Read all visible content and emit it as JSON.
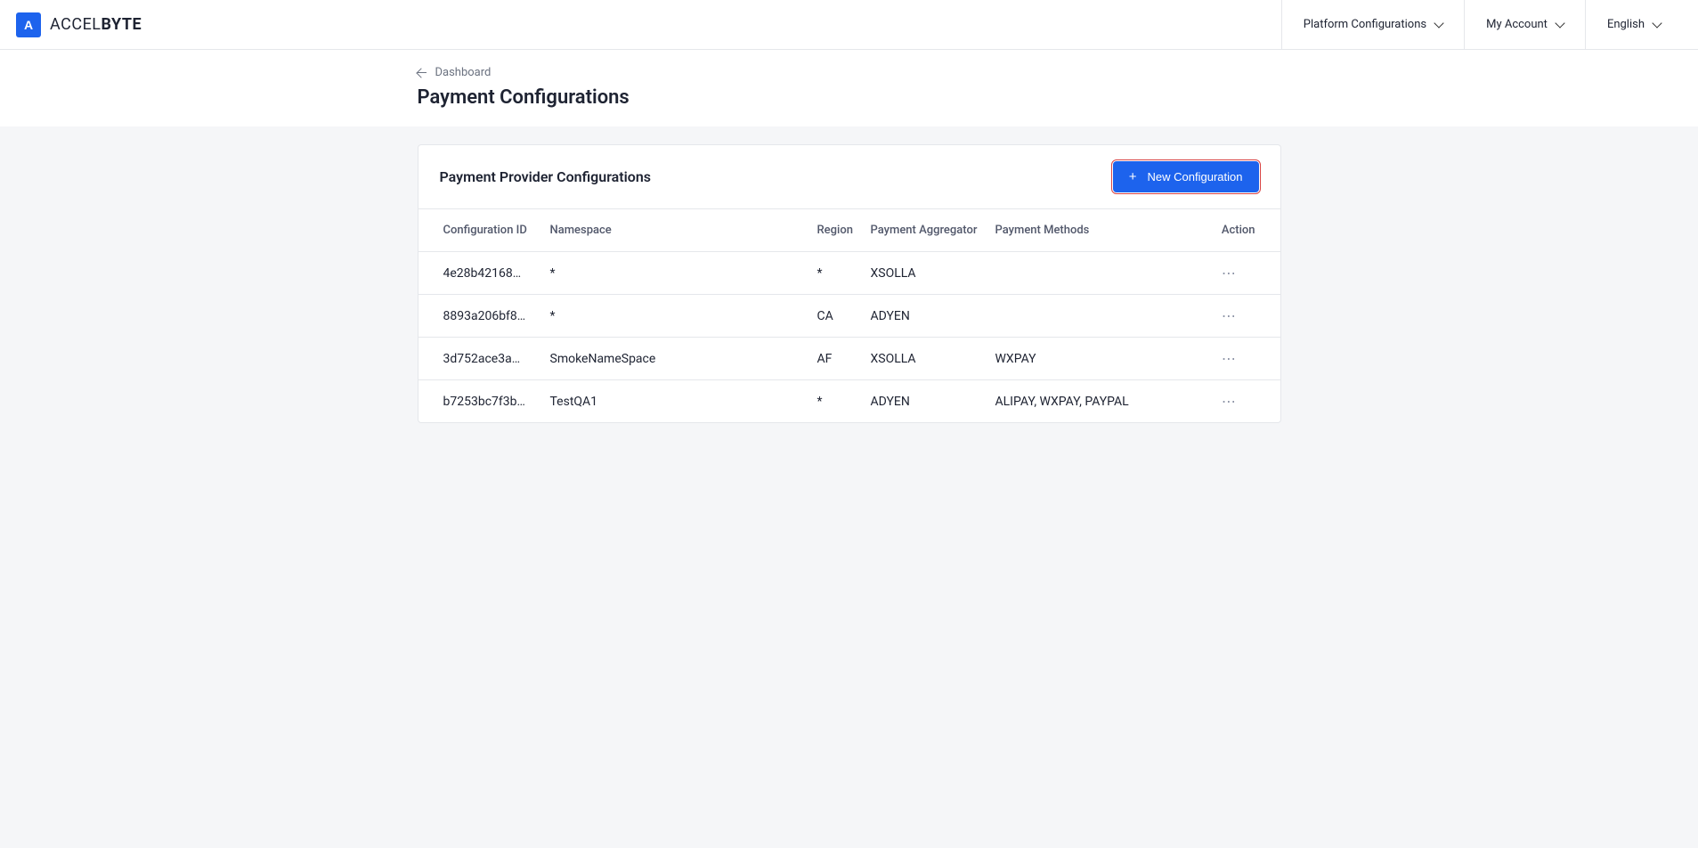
{
  "brand": {
    "name_part1": "ACCEL",
    "name_part2": "BYTE"
  },
  "header": {
    "nav": [
      {
        "label": "Platform Configurations"
      },
      {
        "label": "My Account"
      },
      {
        "label": "English"
      }
    ]
  },
  "breadcrumb": {
    "back_label": "Dashboard"
  },
  "page": {
    "title": "Payment Configurations"
  },
  "card": {
    "title": "Payment Provider Configurations",
    "new_button_label": "New Configuration"
  },
  "table": {
    "headers": {
      "config_id": "Configuration ID",
      "namespace": "Namespace",
      "region": "Region",
      "aggregator": "Payment Aggregator",
      "methods": "Payment Methods",
      "action": "Action"
    },
    "rows": [
      {
        "config_id": "4e28b42168…",
        "namespace": "*",
        "region": "*",
        "aggregator": "XSOLLA",
        "methods": ""
      },
      {
        "config_id": "8893a206bf8…",
        "namespace": "*",
        "region": "CA",
        "aggregator": "ADYEN",
        "methods": ""
      },
      {
        "config_id": "3d752ace3a…",
        "namespace": "SmokeNameSpace",
        "region": "AF",
        "aggregator": "XSOLLA",
        "methods": "WXPAY"
      },
      {
        "config_id": "b7253bc7f3b…",
        "namespace": "TestQA1",
        "region": "*",
        "aggregator": "ADYEN",
        "methods": "ALIPAY, WXPAY, PAYPAL"
      }
    ]
  }
}
